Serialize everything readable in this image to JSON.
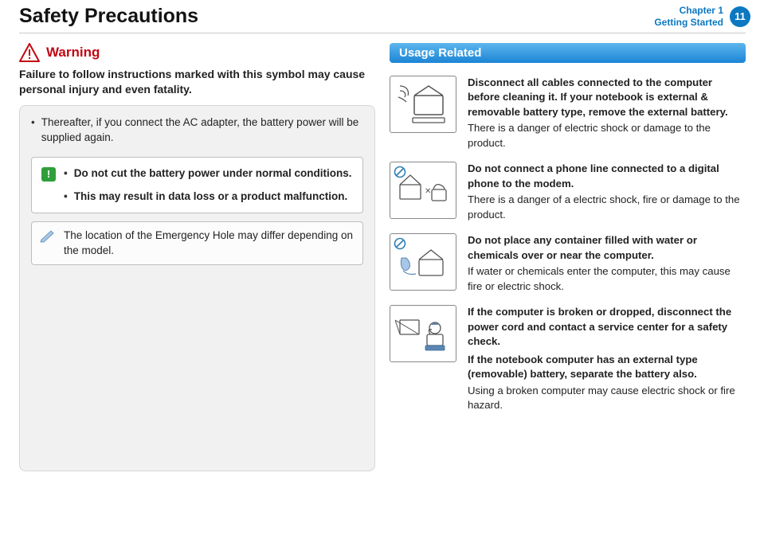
{
  "header": {
    "title": "Safety Precautions",
    "chapter_line1": "Chapter 1",
    "chapter_line2": "Getting Started",
    "page_no": "11"
  },
  "warning": {
    "label": "Warning",
    "text": "Failure to follow instructions marked with this symbol may cause personal injury and even fatality."
  },
  "left": {
    "bullet1": "Thereafter, if you connect the AC adapter, the battery power will be supplied again.",
    "card_bullet1": "Do not cut the battery power under normal conditions.",
    "card_bullet2": "This may result in data loss or a product malfunction.",
    "note": "The location of the Emergency Hole may differ depending on the model."
  },
  "right": {
    "section_title": "Usage Related",
    "items": [
      {
        "bold": "Disconnect all cables connected to the computer before cleaning it. If your notebook is external & removable battery type, remove the external battery.",
        "body": "There is a danger of electric shock or damage to the product."
      },
      {
        "bold": "Do not connect a phone line connected to a digital phone to the modem.",
        "body": "There is a danger of a electric shock, fire or damage to the product."
      },
      {
        "bold": "Do not place any container filled with water or chemicals over or near the computer.",
        "body": "If water or chemicals enter the computer, this may cause fire or electric shock."
      },
      {
        "bold": "If the computer is broken or dropped, disconnect the power cord and contact a service center for a safety check.",
        "bold2": "If the notebook computer has an external type (removable) battery, separate the battery also.",
        "body": "Using a broken computer may cause electric shock or fire hazard."
      }
    ]
  }
}
